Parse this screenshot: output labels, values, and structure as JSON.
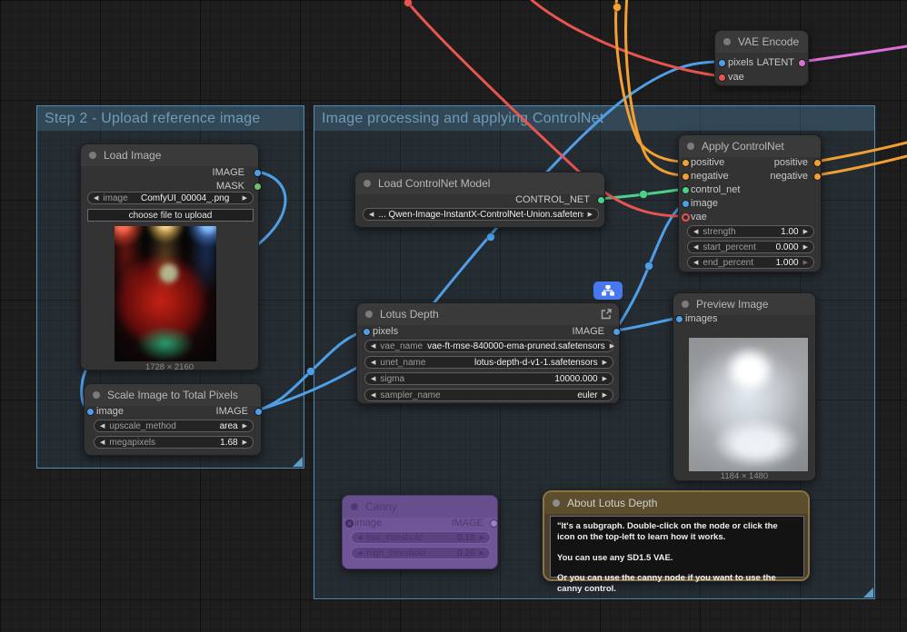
{
  "groups": [
    {
      "title": "Step 2 - Upload reference image"
    },
    {
      "title": "Image processing and applying ControlNet"
    }
  ],
  "nodes": {
    "vae_encode": {
      "title": "VAE Encode",
      "inputs": {
        "pixels": "pixels",
        "vae": "vae"
      },
      "output": "LATENT"
    },
    "load_image": {
      "title": "Load Image",
      "outputs": {
        "image": "IMAGE",
        "mask": "MASK"
      },
      "image_widget": {
        "label": "image",
        "value": "ComfyUI_00004_.png"
      },
      "upload_button": "choose file to upload",
      "caption": "1728 × 2160"
    },
    "scale": {
      "title": "Scale Image to Total Pixels",
      "input": "image",
      "output": "IMAGE",
      "widgets": [
        {
          "label": "upscale_method",
          "value": "area"
        },
        {
          "label": "megapixels",
          "value": "1.68"
        }
      ]
    },
    "load_controlnet": {
      "title": "Load ControlNet Model",
      "output": "CONTROL_NET",
      "widget_value": "... Qwen-Image-InstantX-ControlNet-Union.safetensors"
    },
    "apply_controlnet": {
      "title": "Apply ControlNet",
      "inputs": [
        "positive",
        "negative",
        "control_net",
        "image",
        "vae"
      ],
      "outputs": [
        "positive",
        "negative"
      ],
      "widgets": [
        {
          "label": "strength",
          "value": "1.00"
        },
        {
          "label": "start_percent",
          "value": "0.000"
        },
        {
          "label": "end_percent",
          "value": "1.000"
        }
      ]
    },
    "lotus_depth": {
      "title": "Lotus Depth",
      "input": "pixels",
      "output": "IMAGE",
      "widgets": [
        {
          "label": "vae_name",
          "value": "vae-ft-mse-840000-ema-pruned.safetensors"
        },
        {
          "label": "unet_name",
          "value": "lotus-depth-d-v1-1.safetensors"
        },
        {
          "label": "sigma",
          "value": "10000.000"
        },
        {
          "label": "sampler_name",
          "value": "euler"
        }
      ]
    },
    "preview_image": {
      "title": "Preview Image",
      "input": "images",
      "caption": "1184 × 1480"
    },
    "canny": {
      "title": "Canny",
      "input": "image",
      "output": "IMAGE",
      "widgets": [
        {
          "label": "low_threshold",
          "value": "0.10"
        },
        {
          "label": "high_threshold",
          "value": "0.20"
        }
      ]
    },
    "note": {
      "title": "About Lotus Depth",
      "lines": [
        "\"It's a subgraph. Double-click on the node or click the icon on the top-left to learn how it works.",
        "You can use any SD1.5 VAE.",
        "Or you can use the canny node if you want to use the canny control."
      ]
    }
  },
  "colors": {
    "image_port": "#4f9fe8",
    "mask_port": "#6dbf6d",
    "control_net_port": "#4fd08a",
    "vae_port": "#e85450",
    "latent_port": "#de6fd8",
    "conditioning_port": "#f2a033",
    "group_border": "#4e8cb8",
    "bypass_purple": "#6f5596",
    "note_border": "#8c7440",
    "badge_blue": "#4878f0"
  }
}
